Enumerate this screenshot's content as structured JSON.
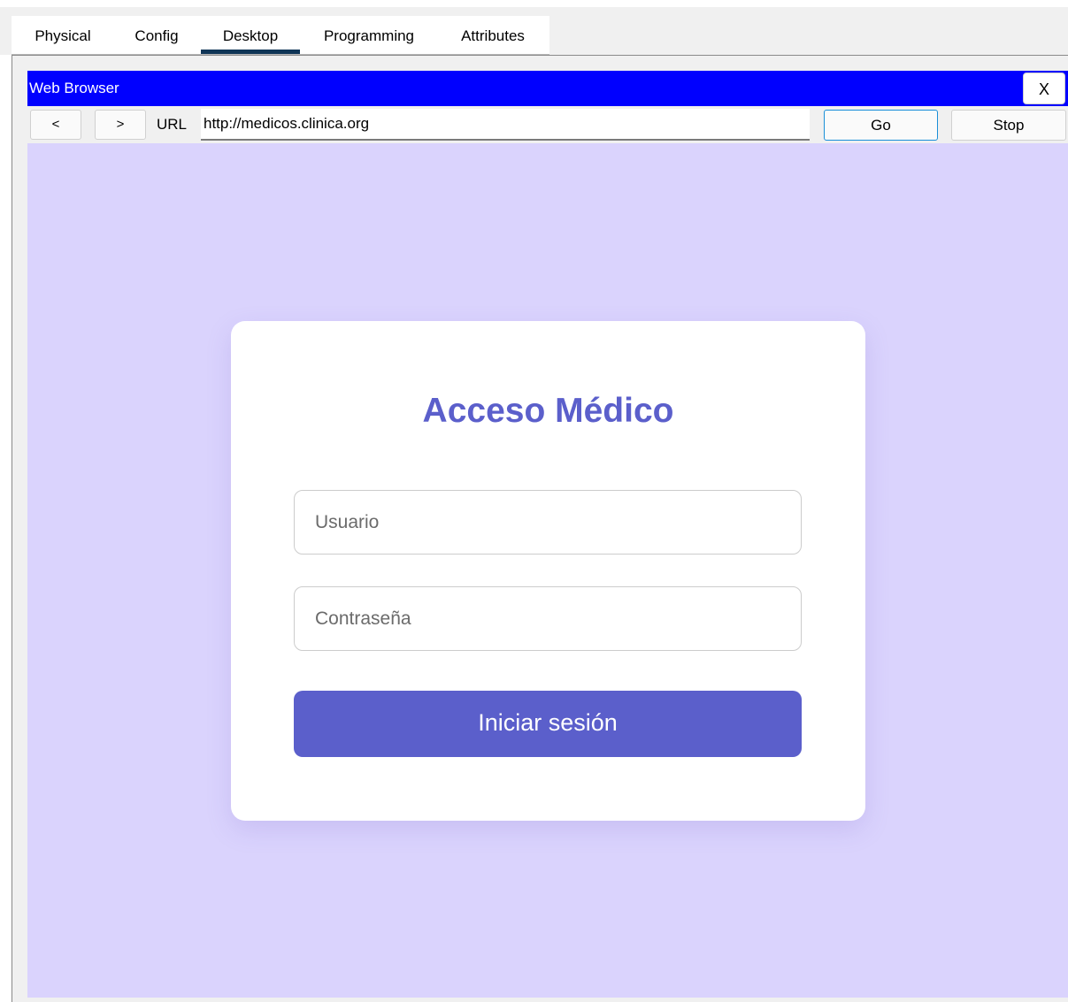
{
  "tabs": [
    {
      "label": "Physical",
      "active": false
    },
    {
      "label": "Config",
      "active": false
    },
    {
      "label": "Desktop",
      "active": true
    },
    {
      "label": "Programming",
      "active": false
    },
    {
      "label": "Attributes",
      "active": false
    }
  ],
  "window": {
    "title": "Web Browser",
    "close_label": "X",
    "titlebar_color": "#0000ff"
  },
  "toolbar": {
    "back_label": "<",
    "forward_label": ">",
    "url_label": "URL",
    "url_value": "http://medicos.clinica.org",
    "go_label": "Go",
    "stop_label": "Stop"
  },
  "page": {
    "background_color": "#dad3fd",
    "accent_color": "#5b5fcb",
    "login": {
      "title": "Acceso Médico",
      "username_placeholder": "Usuario",
      "password_placeholder": "Contraseña",
      "submit_label": "Iniciar sesión"
    }
  }
}
